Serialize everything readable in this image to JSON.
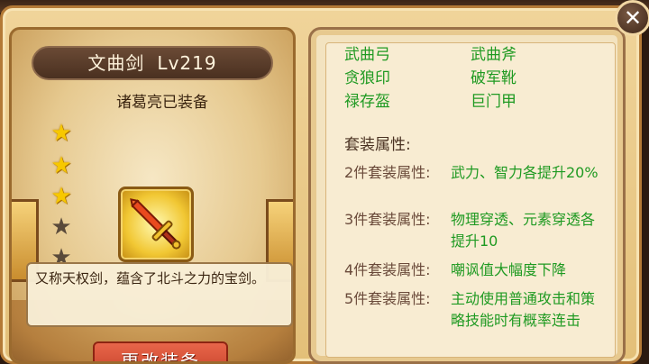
{
  "item": {
    "name": "文曲剑",
    "level": "Lv219",
    "equipped_by": "诸葛亮已装备",
    "stars_total": 5,
    "stars_filled": 3,
    "description": "又称天权剑，蕴含了北斗之力的宝剑。"
  },
  "change_button": {
    "label": "更改装备"
  },
  "set_panel": {
    "set_items": [
      {
        "name": "武曲弓"
      },
      {
        "name": "武曲斧"
      },
      {
        "name": "贪狼印"
      },
      {
        "name": "破军靴"
      },
      {
        "name": "禄存盔"
      },
      {
        "name": "巨门甲"
      }
    ],
    "set_title": "套装属性:",
    "bonuses": [
      {
        "label": "2件套装属性:",
        "value": "武力、智力各提升20%"
      },
      {
        "label": "3件套装属性:",
        "value": "物理穿透、元素穿透各提升10"
      },
      {
        "label": "4件套装属性:",
        "value": "嘲讽值大幅度下降"
      },
      {
        "label": "5件套装属性:",
        "value": "主动使用普通攻击和策略技能时有概率连击"
      }
    ]
  },
  "close_button": {
    "icon": "close-icon",
    "glyph": "✕"
  },
  "colors": {
    "set_item_text": "#1f9a22",
    "bonus_label_text": "#6a4a3a",
    "button_red": "#c23d26",
    "star_gold": "#f7c800"
  }
}
